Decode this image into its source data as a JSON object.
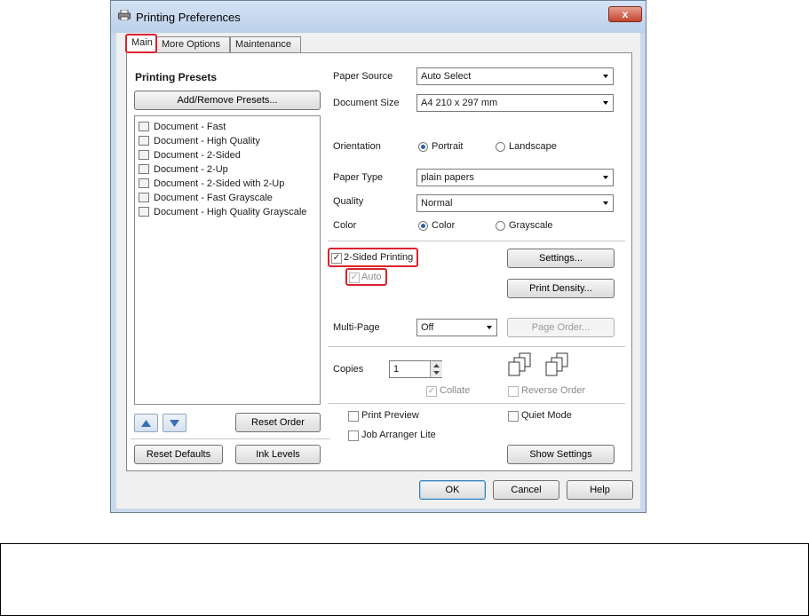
{
  "window": {
    "title": "Printing Preferences",
    "close_glyph": "x",
    "tabs": [
      {
        "label": "Main"
      },
      {
        "label": "More Options"
      },
      {
        "label": "Maintenance"
      }
    ]
  },
  "presets": {
    "heading": "Printing Presets",
    "add_remove_label": "Add/Remove Presets...",
    "items": [
      {
        "label": "Document - Fast"
      },
      {
        "label": "Document - High Quality"
      },
      {
        "label": "Document - 2-Sided"
      },
      {
        "label": "Document - 2-Up"
      },
      {
        "label": "Document - 2-Sided with 2-Up"
      },
      {
        "label": "Document - Fast Grayscale"
      },
      {
        "label": "Document - High Quality Grayscale"
      }
    ],
    "reset_order_label": "Reset Order",
    "reset_defaults_label": "Reset Defaults",
    "ink_levels_label": "Ink Levels"
  },
  "settings": {
    "paper_source_label": "Paper Source",
    "paper_source_value": "Auto Select",
    "document_size_label": "Document Size",
    "document_size_value": "A4 210 x 297 mm",
    "orientation_label": "Orientation",
    "portrait_label": "Portrait",
    "landscape_label": "Landscape",
    "paper_type_label": "Paper Type",
    "paper_type_value": "plain papers",
    "quality_label": "Quality",
    "quality_value": "Normal",
    "color_label": "Color",
    "color_option_label": "Color",
    "grayscale_label": "Grayscale",
    "two_sided_label": "2-Sided Printing",
    "auto_label": "Auto",
    "settings_button_label": "Settings...",
    "print_density_label": "Print Density...",
    "multi_page_label": "Multi-Page",
    "multi_page_value": "Off",
    "page_order_label": "Page Order...",
    "copies_label": "Copies",
    "copies_value": "1",
    "collate_label": "Collate",
    "reverse_order_label": "Reverse Order",
    "print_preview_label": "Print Preview",
    "quiet_mode_label": "Quiet Mode",
    "job_arranger_label": "Job Arranger Lite",
    "show_settings_label": "Show Settings",
    "check_glyph": "✓"
  },
  "footer": {
    "ok_label": "OK",
    "cancel_label": "Cancel",
    "help_label": "Help"
  },
  "colors": {
    "highlight": "#d9232e",
    "title_bar": "#c9d9ee",
    "radio_selected": "#2f5fa8"
  }
}
